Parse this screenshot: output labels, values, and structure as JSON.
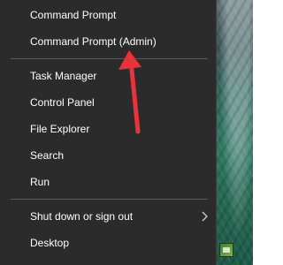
{
  "menu": {
    "items": [
      {
        "label": "Command Prompt",
        "name": "menu-item-command-prompt"
      },
      {
        "label": "Command Prompt (Admin)",
        "name": "menu-item-command-prompt-admin"
      },
      {
        "label": "Task Manager",
        "name": "menu-item-task-manager"
      },
      {
        "label": "Control Panel",
        "name": "menu-item-control-panel"
      },
      {
        "label": "File Explorer",
        "name": "menu-item-file-explorer"
      },
      {
        "label": "Search",
        "name": "menu-item-search"
      },
      {
        "label": "Run",
        "name": "menu-item-run"
      },
      {
        "label": "Shut down or sign out",
        "name": "menu-item-shut-down-or-sign-out",
        "has_submenu": true
      },
      {
        "label": "Desktop",
        "name": "menu-item-desktop"
      }
    ]
  },
  "colors": {
    "menu_background": "#2b2b2b",
    "text": "#ffffff",
    "separator": "#5a5a5a",
    "annotation_arrow": "#e8333b"
  },
  "icons": {
    "submenu": "chevron-right-icon",
    "annotation": "red-arrow"
  }
}
